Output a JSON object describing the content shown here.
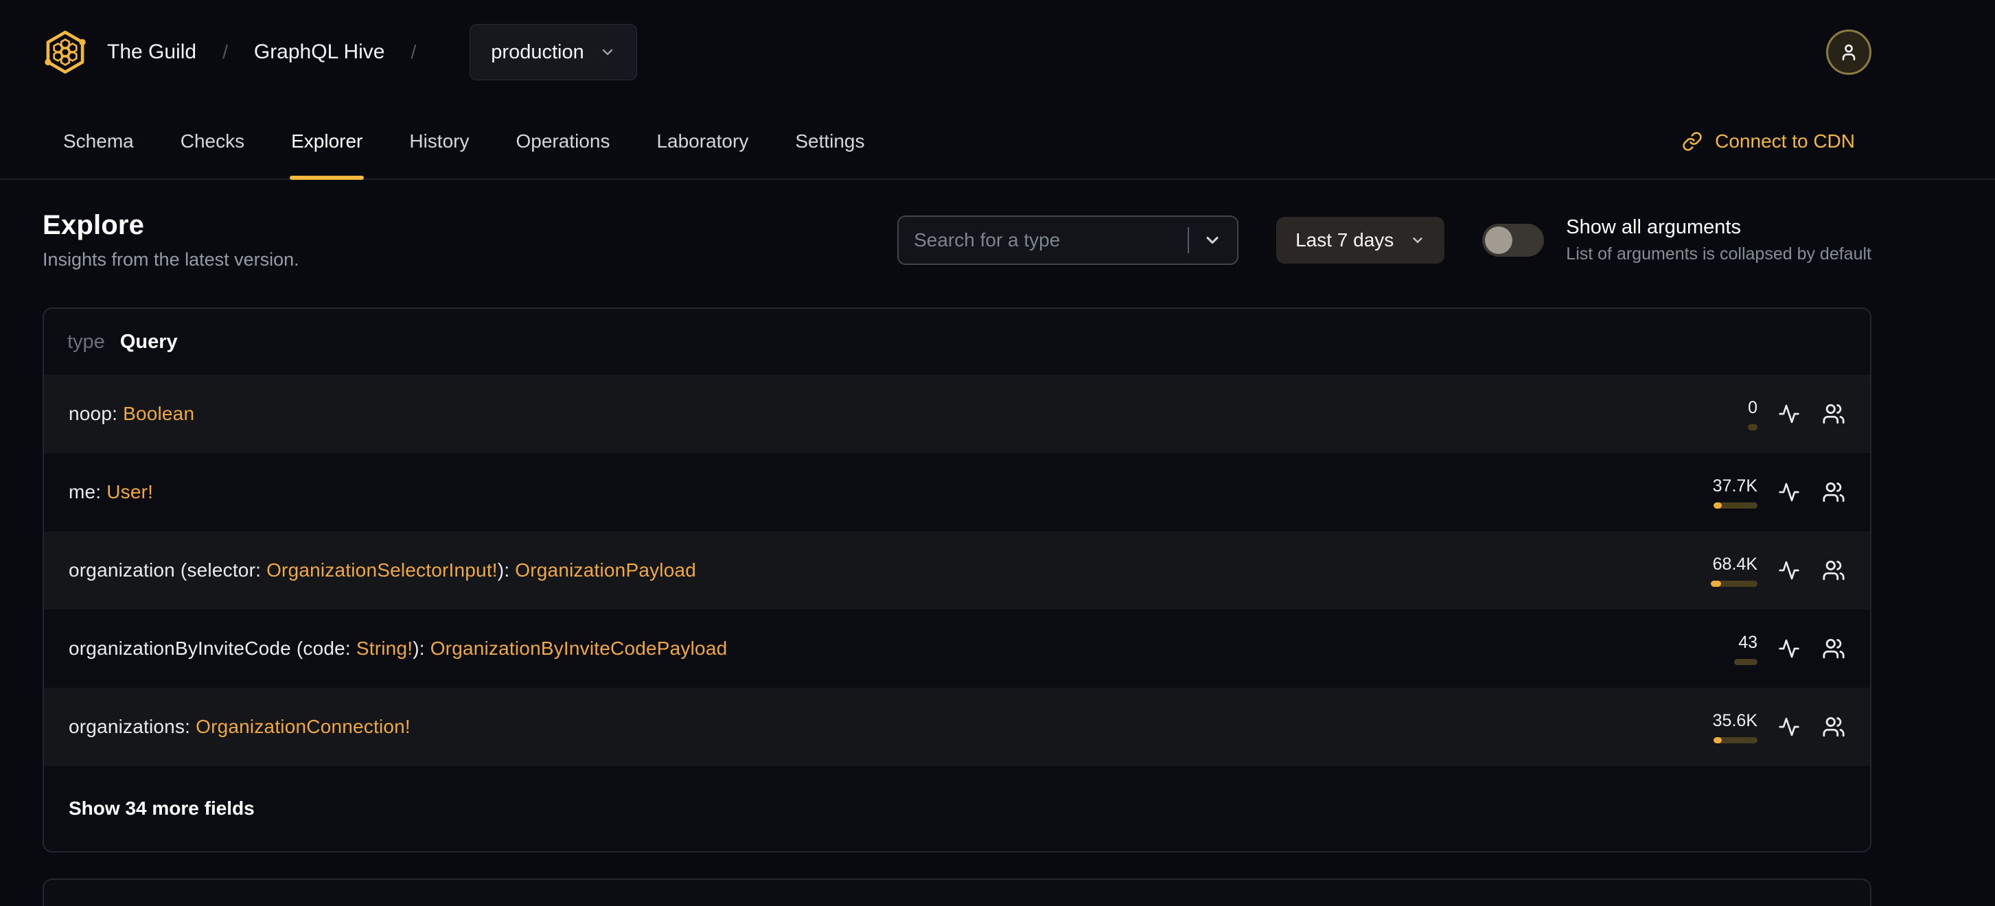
{
  "colors": {
    "accent": "#f4b740",
    "type_link": "#f0a843",
    "bar_fill": "#f1ad3b",
    "bar_track": "#493f1e",
    "page_bg": "#080a0f",
    "row_light": "#15161a",
    "row_dark": "#0a0c11"
  },
  "icons": {
    "logo": "hive-logo",
    "avatar": "person-icon",
    "cdn": "link-icon",
    "dropdown": "chevron-down-icon",
    "field_actions": [
      "activity-icon",
      "users-icon"
    ]
  },
  "header": {
    "org": "The Guild",
    "separator1": "/",
    "project": "GraphQL Hive",
    "separator2": "/",
    "target": "production"
  },
  "nav": {
    "tabs": [
      "Schema",
      "Checks",
      "Explorer",
      "History",
      "Operations",
      "Laboratory",
      "Settings"
    ],
    "active_tab": "Explorer",
    "cdn_label": "Connect to CDN"
  },
  "page": {
    "title": "Explore",
    "subtitle": "Insights from the latest version."
  },
  "controls": {
    "search": {
      "placeholder": "Search for a type"
    },
    "period": {
      "label": "Last 7 days"
    },
    "toggle": {
      "state": "off",
      "label": "Show all arguments",
      "description": "List of arguments is collapsed by default"
    }
  },
  "card": {
    "kind": "type",
    "name": "Query",
    "fields": [
      {
        "segments": [
          {
            "t": "noop: ",
            "k": "plain"
          },
          {
            "t": "Boolean",
            "k": "type"
          }
        ],
        "count": "0",
        "bar": {
          "track": 14,
          "fill": 0
        }
      },
      {
        "segments": [
          {
            "t": "me: ",
            "k": "plain"
          },
          {
            "t": "User!",
            "k": "type"
          }
        ],
        "count": "37.7K",
        "bar": {
          "track": 64,
          "fill": 12
        }
      },
      {
        "segments": [
          {
            "t": "organization (selector: ",
            "k": "plain"
          },
          {
            "t": "OrganizationSelectorInput!",
            "k": "type"
          },
          {
            "t": "): ",
            "k": "plain"
          },
          {
            "t": "OrganizationPayload",
            "k": "type"
          }
        ],
        "count": "68.4K",
        "bar": {
          "track": 68,
          "fill": 15
        }
      },
      {
        "segments": [
          {
            "t": "organizationByInviteCode (code: ",
            "k": "plain"
          },
          {
            "t": "String!",
            "k": "type"
          },
          {
            "t": "): ",
            "k": "plain"
          },
          {
            "t": "OrganizationByInviteCodePayload",
            "k": "type"
          }
        ],
        "count": "43",
        "bar": {
          "track": 34,
          "fill": 0
        }
      },
      {
        "segments": [
          {
            "t": "organizations: ",
            "k": "plain"
          },
          {
            "t": "OrganizationConnection!",
            "k": "type"
          }
        ],
        "count": "35.6K",
        "bar": {
          "track": 64,
          "fill": 12
        }
      }
    ],
    "footer_label": "Show 34 more fields"
  }
}
